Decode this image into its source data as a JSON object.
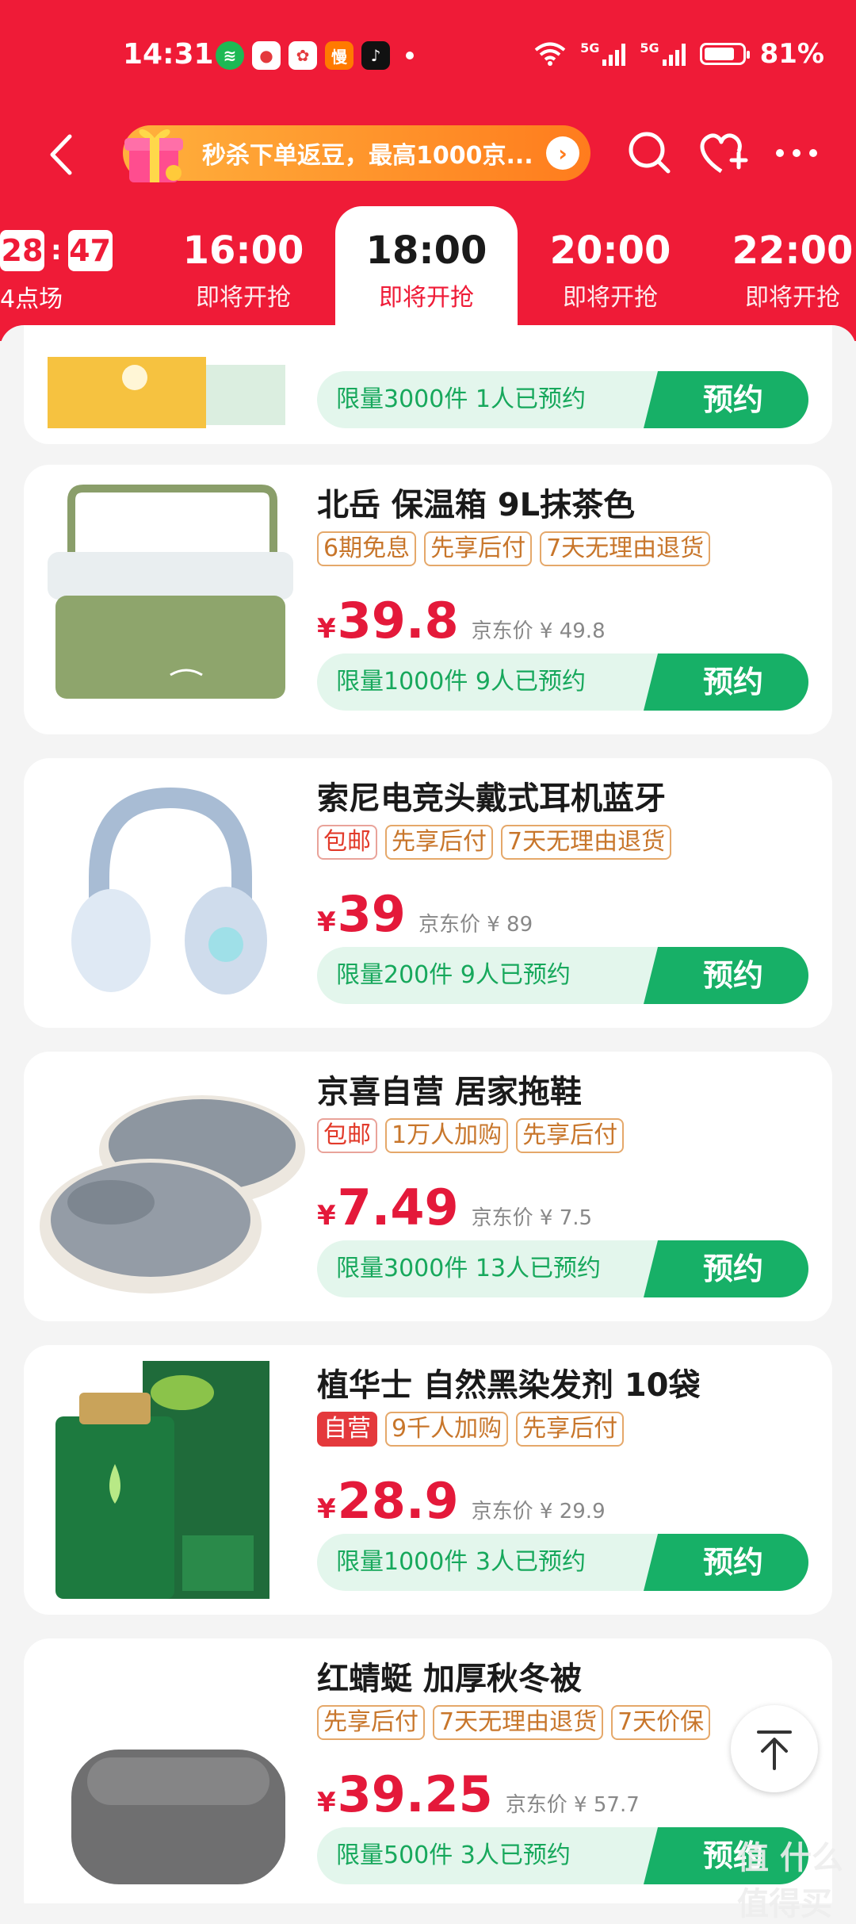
{
  "status": {
    "time": "14:31",
    "battery": "81%",
    "battery_level": 0.81,
    "network": [
      "5G",
      "5G"
    ],
    "notif_icons": [
      "spotify-icon",
      "jd-icon",
      "taobao-icon",
      "slow-icon",
      "tiktok-icon"
    ]
  },
  "nav": {
    "promo_text": "秒杀下单返豆，最高1000京...",
    "colors": {
      "header_red": "#ef1b37",
      "price_red": "#e4193a",
      "reserve_green": "#17b067"
    }
  },
  "tabs": [
    {
      "countdown_m": "28",
      "countdown_s": "47",
      "label": "4点场"
    },
    {
      "time": "16:00",
      "label": "即将开抢"
    },
    {
      "time": "18:00",
      "label": "即将开抢",
      "active": true
    },
    {
      "time": "20:00",
      "label": "即将开抢"
    },
    {
      "time": "22:00",
      "label": "即将开抢"
    }
  ],
  "products": [
    {
      "reserve_text": "限量3000件 1人已预约",
      "reserve_button": "预约"
    },
    {
      "name": "北岳 保温箱 9L抹茶色",
      "tags": [
        "6期免息",
        "先享后付",
        "7天无理由退货"
      ],
      "currency": "¥",
      "price": "39.8",
      "jd_price": "京东价 ¥ 49.8",
      "reserve_text": "限量1000件 9人已预约",
      "reserve_button": "预约"
    },
    {
      "name": "索尼电竞头戴式耳机蓝牙",
      "tags": [
        "包邮",
        "先享后付",
        "7天无理由退货"
      ],
      "currency": "¥",
      "price": "39",
      "jd_price": "京东价 ¥ 89",
      "reserve_text": "限量200件 9人已预约",
      "reserve_button": "预约"
    },
    {
      "name": "京喜自营 居家拖鞋",
      "tags": [
        "包邮",
        "1万人加购",
        "先享后付"
      ],
      "currency": "¥",
      "price": "7.49",
      "jd_price": "京东价 ¥ 7.5",
      "reserve_text": "限量3000件 13人已预约",
      "reserve_button": "预约"
    },
    {
      "name": "植华士 自然黑染发剂 10袋",
      "tags": [
        "自营",
        "9千人加购",
        "先享后付"
      ],
      "currency": "¥",
      "price": "28.9",
      "jd_price": "京东价 ¥ 29.9",
      "reserve_text": "限量1000件 3人已预约",
      "reserve_button": "预约"
    },
    {
      "name": "红蜻蜓 加厚秋冬被",
      "tags": [
        "先享后付",
        "7天无理由退货",
        "7天价保"
      ],
      "currency": "¥",
      "price": "39.25",
      "jd_price": "京东价 ¥ 57.7",
      "reserve_text": "限量500件 3人已预约",
      "reserve_button": "预约"
    }
  ],
  "watermark": "值 什么值得买"
}
